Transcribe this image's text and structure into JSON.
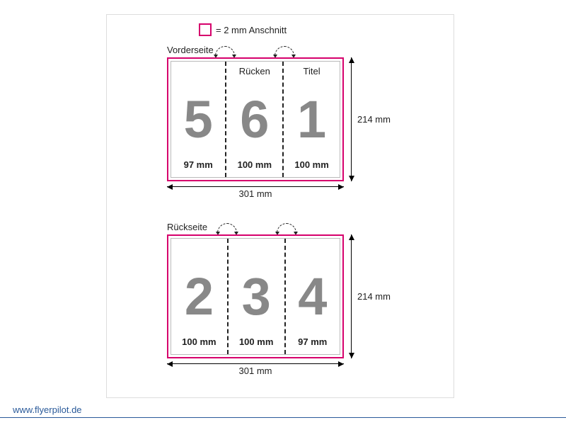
{
  "legend": {
    "text": "= 2 mm Anschnitt"
  },
  "front": {
    "label": "Vorderseite",
    "width": "301 mm",
    "height": "214 mm",
    "panels": [
      {
        "num": "5",
        "head": "",
        "dim": "97 mm"
      },
      {
        "num": "6",
        "head": "Rücken",
        "dim": "100 mm"
      },
      {
        "num": "1",
        "head": "Titel",
        "dim": "100 mm"
      }
    ]
  },
  "back": {
    "label": "Rückseite",
    "width": "301 mm",
    "height": "214 mm",
    "panels": [
      {
        "num": "2",
        "head": "",
        "dim": "100 mm"
      },
      {
        "num": "3",
        "head": "",
        "dim": "100 mm"
      },
      {
        "num": "4",
        "head": "",
        "dim": "97 mm"
      }
    ]
  },
  "footer": {
    "url": "www.flyerpilot.de"
  }
}
